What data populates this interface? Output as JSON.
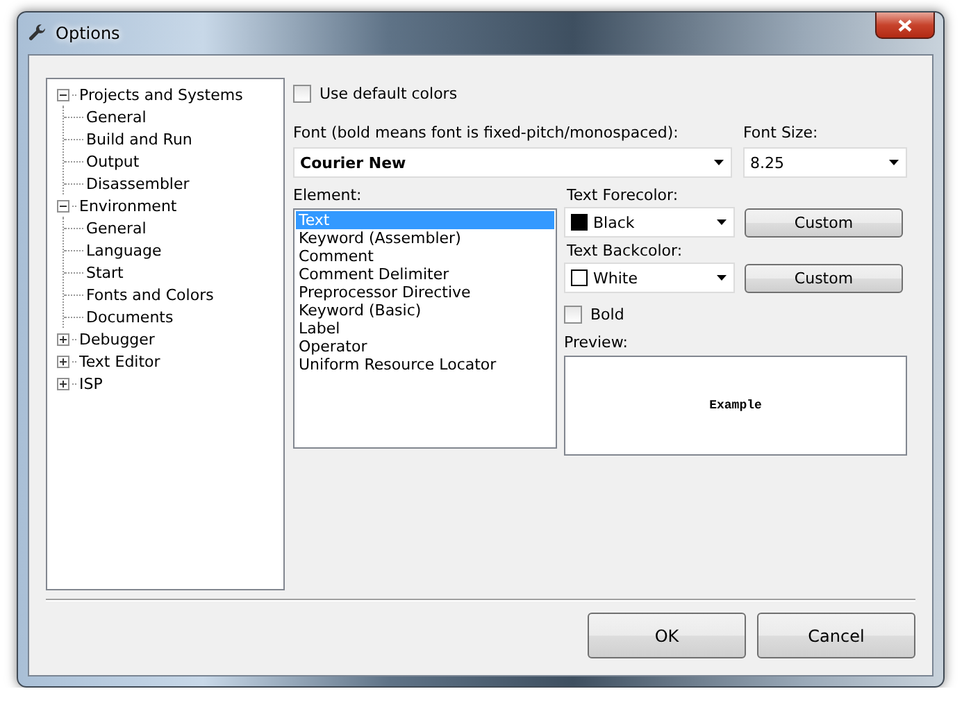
{
  "window": {
    "title": "Options"
  },
  "tree": [
    {
      "label": "Projects and Systems",
      "expanded": true,
      "children": [
        {
          "label": "General"
        },
        {
          "label": "Build and Run"
        },
        {
          "label": "Output"
        },
        {
          "label": "Disassembler"
        }
      ]
    },
    {
      "label": "Environment",
      "expanded": true,
      "children": [
        {
          "label": "General"
        },
        {
          "label": "Language"
        },
        {
          "label": "Start"
        },
        {
          "label": "Fonts and Colors"
        },
        {
          "label": "Documents"
        }
      ]
    },
    {
      "label": "Debugger",
      "expanded": false
    },
    {
      "label": "Text Editor",
      "expanded": false
    },
    {
      "label": "ISP",
      "expanded": false
    }
  ],
  "use_default_colors": {
    "label": "Use default colors",
    "checked": false
  },
  "font": {
    "label": "Font (bold means font is fixed-pitch/monospaced):",
    "value": "Courier New"
  },
  "font_size": {
    "label": "Font Size:",
    "value": "8.25"
  },
  "element": {
    "label": "Element:",
    "items": [
      {
        "label": "Text",
        "selected": true
      },
      {
        "label": "Keyword (Assembler)",
        "selected": false
      },
      {
        "label": "Comment",
        "selected": false
      },
      {
        "label": "Comment Delimiter",
        "selected": false
      },
      {
        "label": "Preprocessor Directive",
        "selected": false
      },
      {
        "label": "Keyword (Basic)",
        "selected": false
      },
      {
        "label": "Label",
        "selected": false
      },
      {
        "label": "Operator",
        "selected": false
      },
      {
        "label": "Uniform Resource Locator",
        "selected": false
      }
    ]
  },
  "colors": [
    {
      "label": "Text Forecolor:",
      "value": "Black",
      "color": "#000000",
      "button": "Custom"
    },
    {
      "label": "Text Backcolor:",
      "value": "White",
      "color": "#ffffff",
      "button": "Custom"
    }
  ],
  "bold": {
    "label": "Bold",
    "checked": false
  },
  "preview": {
    "label": "Preview:",
    "sample": "Example"
  },
  "buttons": [
    "OK",
    "Cancel"
  ]
}
